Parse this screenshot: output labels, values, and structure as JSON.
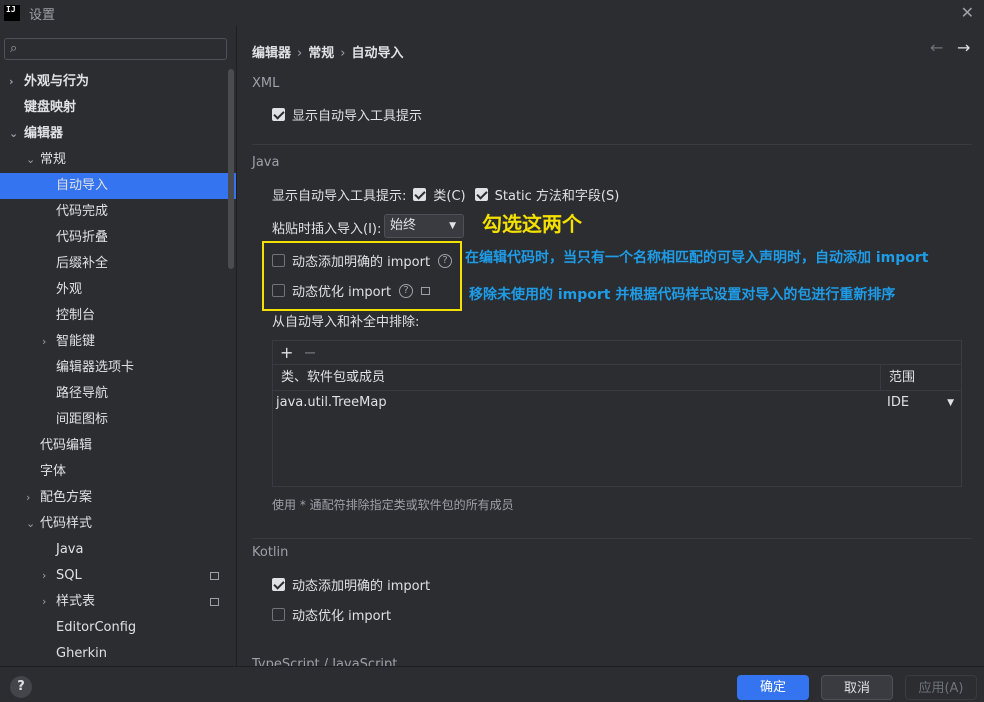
{
  "window": {
    "title": "设置",
    "logo_text": "IJ"
  },
  "sidebar": {
    "search_placeholder": "",
    "items": [
      {
        "label": "外观与行为",
        "chevron": "›",
        "indent": 0,
        "bold": true
      },
      {
        "label": "键盘映射",
        "chevron": "",
        "indent": 0,
        "bold": true
      },
      {
        "label": "编辑器",
        "chevron": "⌄",
        "indent": 0,
        "bold": true
      },
      {
        "label": "常规",
        "chevron": "⌄",
        "indent": 1,
        "bold": false
      },
      {
        "label": "自动导入",
        "chevron": "",
        "indent": 2,
        "bold": false,
        "selected": true
      },
      {
        "label": "代码完成",
        "chevron": "",
        "indent": 2
      },
      {
        "label": "代码折叠",
        "chevron": "",
        "indent": 2
      },
      {
        "label": "后缀补全",
        "chevron": "",
        "indent": 2
      },
      {
        "label": "外观",
        "chevron": "",
        "indent": 2
      },
      {
        "label": "控制台",
        "chevron": "",
        "indent": 2
      },
      {
        "label": "智能键",
        "chevron": "›",
        "indent": 2
      },
      {
        "label": "编辑器选项卡",
        "chevron": "",
        "indent": 2
      },
      {
        "label": "路径导航",
        "chevron": "",
        "indent": 2
      },
      {
        "label": "间距图标",
        "chevron": "",
        "indent": 2
      },
      {
        "label": "代码编辑",
        "chevron": "",
        "indent": 1
      },
      {
        "label": "字体",
        "chevron": "",
        "indent": 1
      },
      {
        "label": "配色方案",
        "chevron": "›",
        "indent": 1
      },
      {
        "label": "代码样式",
        "chevron": "⌄",
        "indent": 1
      },
      {
        "label": "Java",
        "chevron": "",
        "indent": 2
      },
      {
        "label": "SQL",
        "chevron": "›",
        "indent": 2,
        "mark": true
      },
      {
        "label": "样式表",
        "chevron": "›",
        "indent": 2,
        "mark": true
      },
      {
        "label": "EditorConfig",
        "chevron": "",
        "indent": 2
      },
      {
        "label": "Gherkin",
        "chevron": "",
        "indent": 2
      }
    ]
  },
  "breadcrumb": {
    "part1": "编辑器",
    "part2": "常规",
    "part3": "自动导入"
  },
  "xml": {
    "title": "XML",
    "show_tooltip": {
      "label": "显示自动导入工具提示",
      "checked": true
    }
  },
  "java": {
    "title": "Java",
    "tooltip_label": "显示自动导入工具提示:",
    "tooltip_class": {
      "label": "类(C)",
      "checked": true
    },
    "tooltip_static": {
      "label": "Static 方法和字段(S)",
      "checked": true
    },
    "paste_label": "粘贴时插入导入(I):",
    "paste_value": "始终",
    "add_unambiguous": {
      "label": "动态添加明确的 import",
      "checked": false
    },
    "optimize": {
      "label": "动态优化 import",
      "checked": false
    },
    "exclude_label": "从自动导入和补全中排除:",
    "table": {
      "col1": "类、软件包或成员",
      "col2": "范围",
      "rows": [
        {
          "name": "java.util.TreeMap",
          "scope": "IDE"
        }
      ]
    },
    "hint": "使用 * 通配符排除指定类或软件包的所有成员"
  },
  "annotation": {
    "title": "勾选这两个",
    "note1": "在编辑代码时，当只有一个名称相匹配的可导入声明时，自动添加 import",
    "note2": "移除未使用的 import 并根据代码样式设置对导入的包进行重新排序",
    "color_box": "#f5e100",
    "color_text": "#1e9ce8"
  },
  "kotlin": {
    "title": "Kotlin",
    "add_unambiguous": {
      "label": "动态添加明确的 import",
      "checked": true
    },
    "optimize": {
      "label": "动态优化 import",
      "checked": false
    }
  },
  "next_section": {
    "title": "TypeScript / JavaScript"
  },
  "footer": {
    "help": "?",
    "ok": "确定",
    "cancel": "取消",
    "apply": "应用(A)"
  },
  "colors": {
    "accent": "#3574f0",
    "bg": "#2b2d30",
    "selected": "#2e436e"
  }
}
